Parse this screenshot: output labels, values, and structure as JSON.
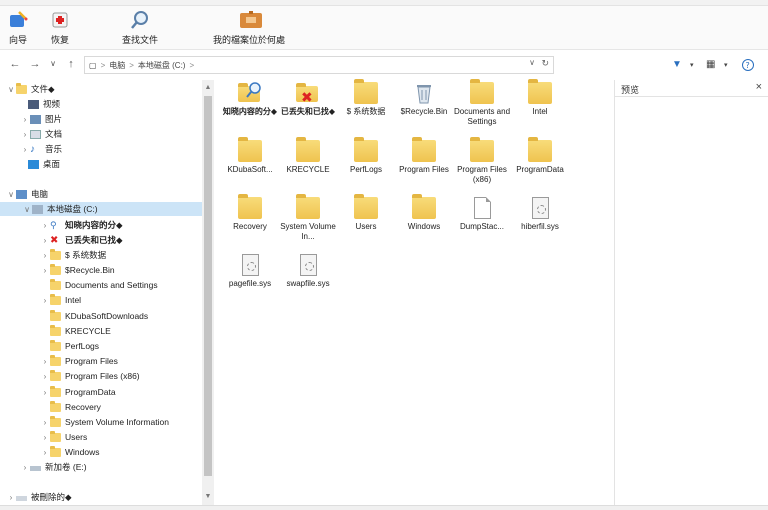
{
  "ribbon": {
    "wizard": "向导",
    "restore": "恢复",
    "find": "查找文件",
    "archive": "我的檔案位於何處"
  },
  "address": {
    "crumbs": [
      "电脑",
      "本地磁盘 (C:)"
    ],
    "separator": ">"
  },
  "tree": {
    "files_label": "文件◆",
    "videos": "视频",
    "pictures": "图片",
    "documents": "文档",
    "music": "音乐",
    "desktop": "桌面",
    "computer": "电脑",
    "local_disk": "本地磁盘 (C:)",
    "known_content": "知晓内容的分◆",
    "lost_found": "已丢失和已找◆",
    "sys_data": "$ 系统数据",
    "recycle": "$Recycle.Bin",
    "docs_settings": "Documents and Settings",
    "intel": "Intel",
    "kduba": "KDubaSoftDownloads",
    "krecycle": "KRECYCLE",
    "perflogs": "PerfLogs",
    "program_files": "Program Files",
    "program_files_x86": "Program Files (x86)",
    "program_data": "ProgramData",
    "recovery": "Recovery",
    "svi": "System Volume Information",
    "users": "Users",
    "windows": "Windows",
    "new_volume": "新加卷 (E:)",
    "recorded": "被刪除的◆"
  },
  "items": [
    {
      "label": "知晓内容的分◆",
      "kind": "search"
    },
    {
      "label": "已丢失和已找◆",
      "kind": "lost"
    },
    {
      "label": "$ 系统数据",
      "kind": "folder"
    },
    {
      "label": "$Recycle.Bin",
      "kind": "recycle"
    },
    {
      "label": "Documents and Settings",
      "kind": "folder"
    },
    {
      "label": "Intel",
      "kind": "folder"
    },
    {
      "label": "KDubaSoft...",
      "kind": "folder"
    },
    {
      "label": "KRECYCLE",
      "kind": "folder"
    },
    {
      "label": "PerfLogs",
      "kind": "folder"
    },
    {
      "label": "Program Files",
      "kind": "folder"
    },
    {
      "label": "Program Files (x86)",
      "kind": "folder"
    },
    {
      "label": "ProgramData",
      "kind": "folder"
    },
    {
      "label": "Recovery",
      "kind": "folder"
    },
    {
      "label": "System Volume In...",
      "kind": "folder"
    },
    {
      "label": "Users",
      "kind": "folder"
    },
    {
      "label": "Windows",
      "kind": "folder"
    },
    {
      "label": "DumpStac...",
      "kind": "file"
    },
    {
      "label": "hiberfil.sys",
      "kind": "sys"
    },
    {
      "label": "pagefile.sys",
      "kind": "sys"
    },
    {
      "label": "swapfile.sys",
      "kind": "sys"
    }
  ],
  "preview": {
    "title": "预览",
    "close": "×"
  },
  "colors": {
    "folder": "#f6d36b",
    "selection": "#cce4f7",
    "accent": "#1e73d6"
  }
}
